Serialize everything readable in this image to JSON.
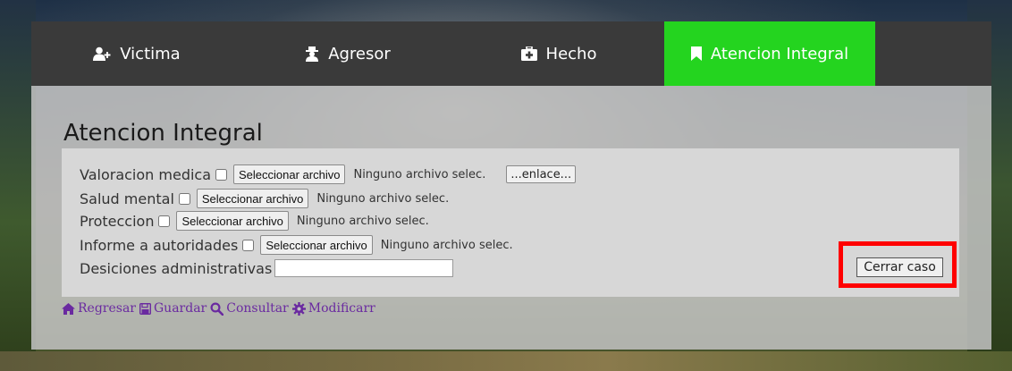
{
  "nav": {
    "tabs": [
      {
        "label": "Victima",
        "icon": "user-plus-icon",
        "active": false
      },
      {
        "label": "Agresor",
        "icon": "user-secret-icon",
        "active": false
      },
      {
        "label": "Hecho",
        "icon": "medkit-icon",
        "active": false
      },
      {
        "label": "Atencion Integral",
        "icon": "bookmark-icon",
        "active": true
      }
    ],
    "active_color": "#24d41f"
  },
  "page": {
    "title": "Atencion Integral"
  },
  "form": {
    "rows": [
      {
        "label": "Valoracion medica",
        "file_button": "Seleccionar archivo",
        "file_status": "Ninguno archivo selec.",
        "extra_button": "...enlace..."
      },
      {
        "label": "Salud mental",
        "file_button": "Seleccionar archivo",
        "file_status": "Ninguno archivo selec."
      },
      {
        "label": "Proteccion",
        "file_button": "Seleccionar archivo",
        "file_status": "Ninguno archivo selec."
      },
      {
        "label": "Informe a autoridades",
        "file_button": "Seleccionar archivo",
        "file_status": "Ninguno archivo selec."
      }
    ],
    "decisions_label": "Desiciones administrativas",
    "decisions_value": "",
    "close_button": "Cerrar caso",
    "highlight_color": "#ff0000"
  },
  "actions": [
    {
      "label": "Regresar",
      "icon": "home-icon"
    },
    {
      "label": "Guardar",
      "icon": "save-icon"
    },
    {
      "label": "Consultar",
      "icon": "search-icon"
    },
    {
      "label": "Modificarr",
      "icon": "gear-icon"
    }
  ]
}
